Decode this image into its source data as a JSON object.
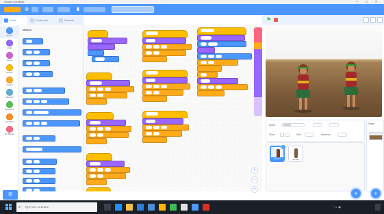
{
  "window": {
    "title": "Scratch Desktop",
    "controls": [
      "–",
      "□",
      "×"
    ]
  },
  "menubar": {
    "project_title": "Scratch Project"
  },
  "tabs": [
    {
      "label": "Code",
      "active": true
    },
    {
      "label": "Costumes",
      "active": false
    },
    {
      "label": "Sounds",
      "active": false
    }
  ],
  "categories": [
    {
      "label": "Motion",
      "color": "#4c97ff"
    },
    {
      "label": "Looks",
      "color": "#9966ff"
    },
    {
      "label": "Sound",
      "color": "#cf63cf"
    },
    {
      "label": "Events",
      "color": "#ffbf00"
    },
    {
      "label": "Control",
      "color": "#ffab19"
    },
    {
      "label": "Sensing",
      "color": "#5cb1d6"
    },
    {
      "label": "Operators",
      "color": "#59c059"
    },
    {
      "label": "Variables",
      "color": "#ff8c1a"
    },
    {
      "label": "My Blocks",
      "color": "#ff6680"
    }
  ],
  "palette": {
    "heading": "Motion"
  },
  "sprite_info": {
    "sprite_label": "Sprite",
    "sprite_name": "Sprite1",
    "show_label": "Show",
    "size_label": "Size",
    "direction_label": "Direction"
  },
  "sprites": [
    {
      "name": "Sprite1",
      "selected": true
    },
    {
      "name": "Sprite2",
      "selected": false
    }
  ],
  "stage_panel": {
    "label": "Stage"
  },
  "taskbar": {
    "search_placeholder": "Type here to search"
  },
  "icons": {
    "flag": "green-flag-icon",
    "stop": "stop-icon",
    "add_sprite": "add-sprite-icon",
    "add_backdrop": "add-backdrop-icon",
    "extension": "add-extension-icon",
    "zoom_in": "zoom-in-icon",
    "zoom_out": "zoom-out-icon",
    "zoom_reset": "zoom-reset-icon"
  }
}
